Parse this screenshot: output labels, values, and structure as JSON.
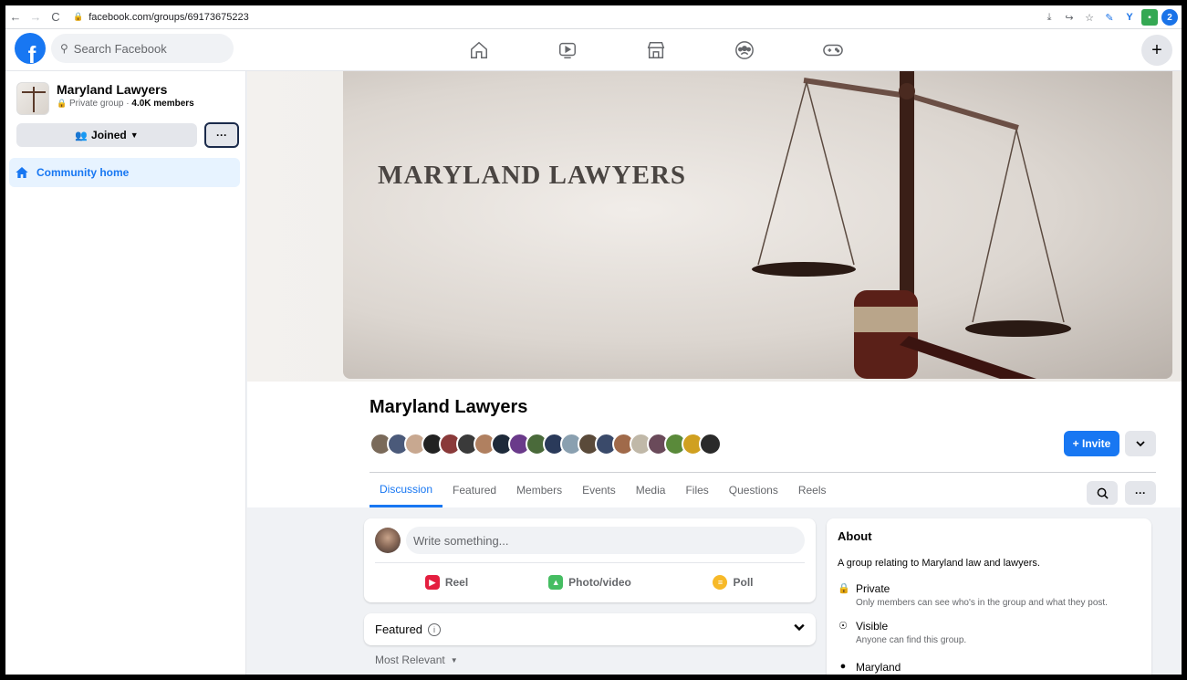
{
  "browser": {
    "url": "facebook.com/groups/69173675223",
    "back_icon": "←",
    "forward_icon": "→",
    "reload_icon": "C"
  },
  "fb": {
    "search_placeholder": "Search Facebook",
    "logo_letter": "f",
    "create_label": "+"
  },
  "sidebar": {
    "group_name": "Maryland Lawyers",
    "group_meta_prefix": "Private group · ",
    "group_members": "4.0K members",
    "joined_label": "Joined",
    "more_label": "···",
    "community_home": "Community home"
  },
  "cover": {
    "title": "MARYLAND LAWYERS"
  },
  "group": {
    "title": "Maryland Lawyers",
    "invite_label": "+ Invite"
  },
  "tabs": [
    "Discussion",
    "Featured",
    "Members",
    "Events",
    "Media",
    "Files",
    "Questions",
    "Reels"
  ],
  "composer": {
    "placeholder": "Write something...",
    "reel": "Reel",
    "photo": "Photo/video",
    "poll": "Poll"
  },
  "featured": {
    "label": "Featured",
    "sort": "Most Relevant"
  },
  "about": {
    "heading": "About",
    "description": "A group relating to Maryland law and lawyers.",
    "private_title": "Private",
    "private_sub": "Only members can see who's in the group and what they post.",
    "visible_title": "Visible",
    "visible_sub": "Anyone can find this group.",
    "location": "Maryland"
  },
  "colors": {
    "accent": "#1877f2",
    "reel": "#e41e3f",
    "photo": "#45bd62",
    "poll": "#f7b928"
  }
}
